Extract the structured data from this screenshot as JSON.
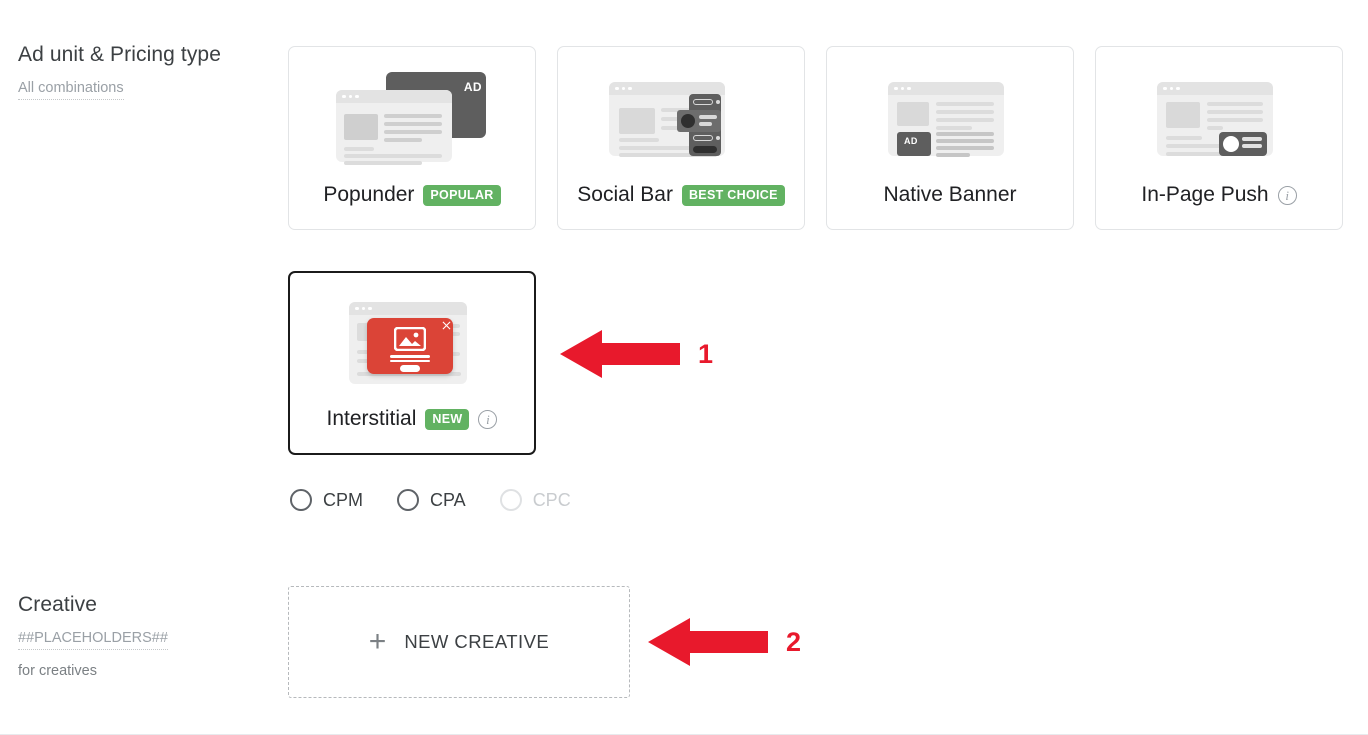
{
  "sections": {
    "ad_unit": {
      "title": "Ad unit & Pricing type",
      "sub_link": "All combinations"
    },
    "creative": {
      "title": "Creative",
      "sub_link": "##PLACEHOLDERS##",
      "sub_plain": "for creatives"
    }
  },
  "ad_units": [
    {
      "name": "Popunder",
      "badge": "POPULAR",
      "badge_color": "#62b262",
      "has_info": false,
      "selected": false,
      "art": "popunder"
    },
    {
      "name": "Social Bar",
      "badge": "BEST CHOICE",
      "badge_color": "#62b262",
      "has_info": false,
      "selected": false,
      "art": "social-bar"
    },
    {
      "name": "Native Banner",
      "badge": "",
      "badge_color": "",
      "has_info": false,
      "selected": false,
      "art": "native-banner"
    },
    {
      "name": "In-Page Push",
      "badge": "",
      "badge_color": "",
      "has_info": true,
      "selected": false,
      "art": "in-page-push"
    },
    {
      "name": "Interstitial",
      "badge": "NEW",
      "badge_color": "#62b262",
      "has_info": true,
      "selected": true,
      "art": "interstitial"
    }
  ],
  "pricing_types": [
    {
      "label": "CPM",
      "selected": false,
      "disabled": false
    },
    {
      "label": "CPA",
      "selected": false,
      "disabled": false
    },
    {
      "label": "CPC",
      "selected": false,
      "disabled": true
    }
  ],
  "new_creative": {
    "label": "NEW CREATIVE",
    "icon": "plus-icon"
  },
  "annotations": [
    {
      "number": "1",
      "direction": "left",
      "color": "#e8192c"
    },
    {
      "number": "2",
      "direction": "left",
      "color": "#e8192c"
    }
  ],
  "icons": {
    "info": "info-circle-icon",
    "ad_label": "AD"
  }
}
